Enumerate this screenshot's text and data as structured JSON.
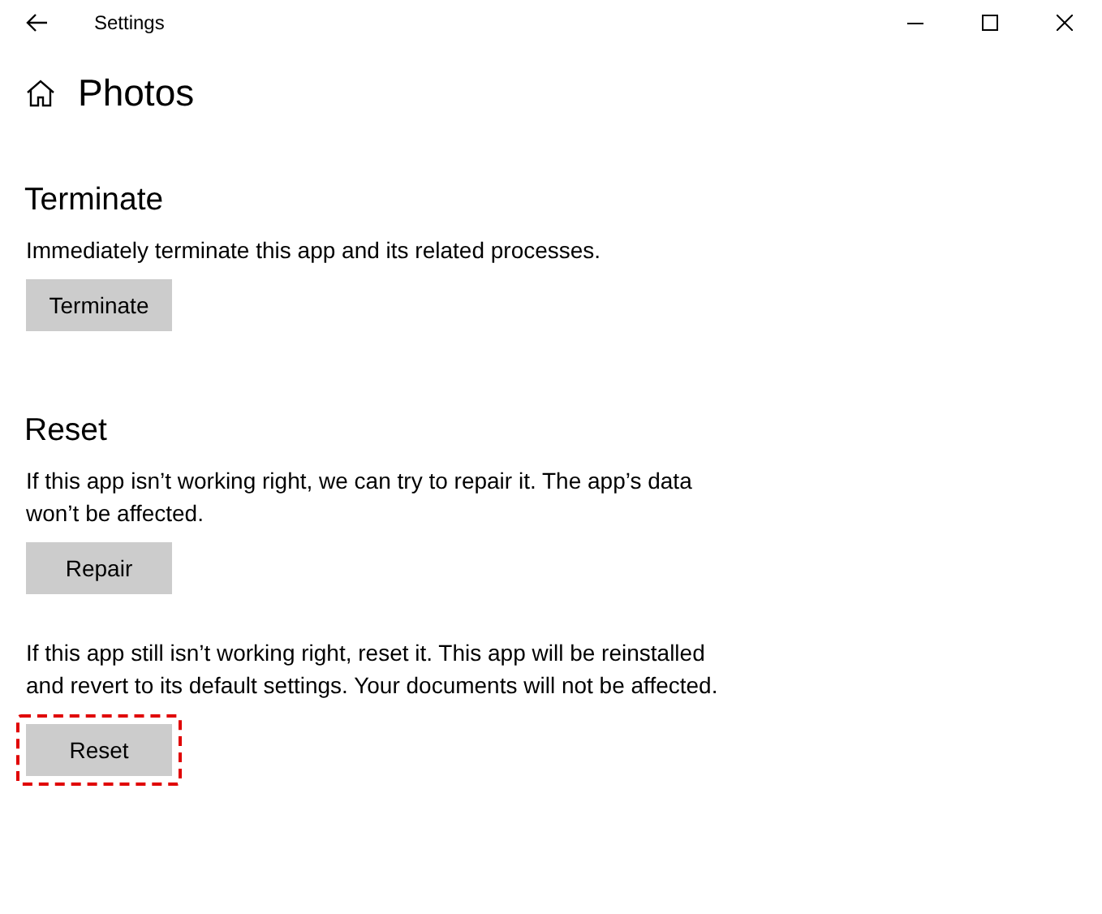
{
  "window": {
    "title": "Settings"
  },
  "page": {
    "title": "Photos"
  },
  "sections": [
    {
      "heading": "Terminate",
      "blocks": [
        {
          "text": "Immediately terminate this app and its related processes.",
          "button": {
            "label": "Terminate",
            "highlighted": false
          }
        }
      ]
    },
    {
      "heading": "Reset",
      "blocks": [
        {
          "text": "If this app isn’t working right, we can try to repair it. The app’s data won’t be affected.",
          "button": {
            "label": "Repair",
            "highlighted": false
          }
        },
        {
          "text": "If this app still isn’t working right, reset it. This app will be reinstalled and revert to its default settings. Your documents will not be affected.",
          "button": {
            "label": "Reset",
            "highlighted": true
          }
        }
      ]
    }
  ]
}
